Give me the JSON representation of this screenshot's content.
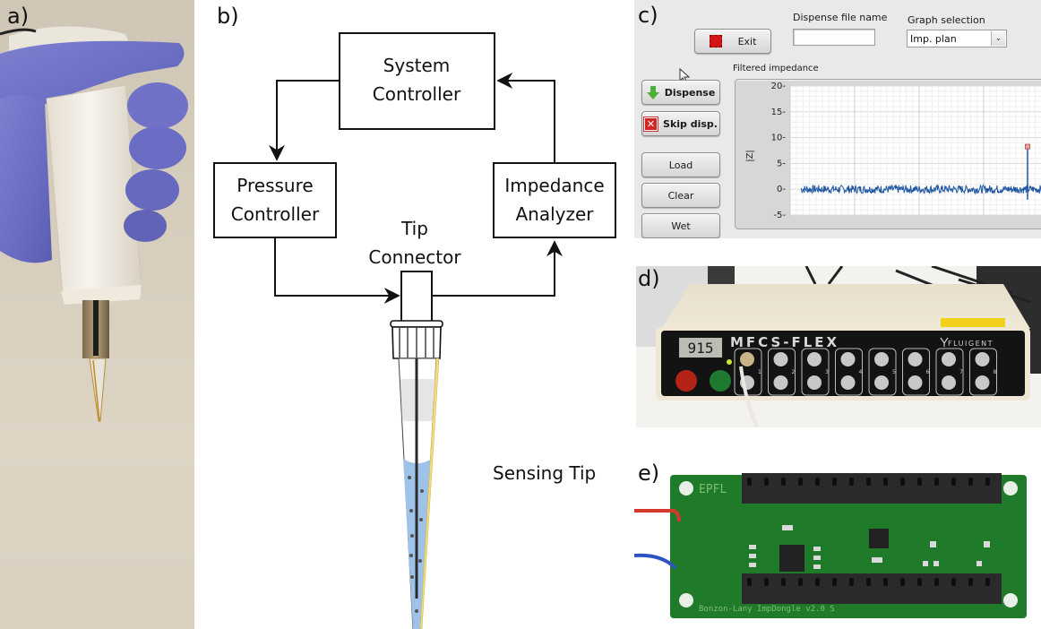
{
  "panels": {
    "a": {
      "label": "a)",
      "description": "Gloved hand holding handheld pipette with sensing tip"
    },
    "b": {
      "label": "b)",
      "blocks": {
        "system_controller": [
          "System",
          "Controller"
        ],
        "pressure_controller": [
          "Pressure",
          "Controller"
        ],
        "impedance_analyzer": [
          "Impedance",
          "Analyzer"
        ],
        "tip_connector": [
          "Tip",
          "Connector"
        ]
      },
      "sensing_tip_label": "Sensing Tip",
      "colors": {
        "liquid": "#9fc3e8",
        "electrode": "#f4dc78",
        "air_gap": "#e3e5e6",
        "line": "#111111"
      }
    },
    "c": {
      "label": "c)",
      "exit_button": "Exit",
      "dispense_file_label": "Dispense file name",
      "dispense_file_value": "",
      "graph_selection_label": "Graph selection",
      "graph_selection_value": "Imp. plan",
      "graph_title": "Filtered impedance",
      "buttons": {
        "dispense": "Dispense",
        "skip": "Skip disp.",
        "load": "Load",
        "clear": "Clear",
        "wet": "Wet"
      },
      "colors": {
        "signal": "#1f57a0",
        "exit_square": "#d31515",
        "skip_icon": "#d42525",
        "dispense_icon": "#4caf3c"
      }
    },
    "d": {
      "label": "d)",
      "device_name": "MFCS-FLEX",
      "brand": "FLUIGENT",
      "display_value": "915",
      "channels": [
        "1",
        "2",
        "3",
        "4",
        "5",
        "6",
        "7",
        "8"
      ]
    },
    "e": {
      "label": "e)",
      "silkscreen_top": "EPFL",
      "silkscreen_bottom": "Bonzon-Lany ImpDongle v2.0 S"
    }
  },
  "chart_data": {
    "type": "line",
    "title": "Filtered impedance",
    "xlabel": "",
    "ylabel": "|Z|",
    "ylim": [
      -5,
      20
    ],
    "yticks": [
      20,
      15,
      10,
      5,
      0,
      -5
    ],
    "grid": true,
    "series": [
      {
        "name": "Filtered impedance",
        "description": "noisy baseline around 0 with amplitude ~±0.8 across the visible time window, single spike at ~92% of window",
        "baseline": 0,
        "noise_amplitude": 0.8,
        "spike": {
          "x_fraction": 0.92,
          "peak": 8,
          "trough": -2
        }
      }
    ]
  }
}
